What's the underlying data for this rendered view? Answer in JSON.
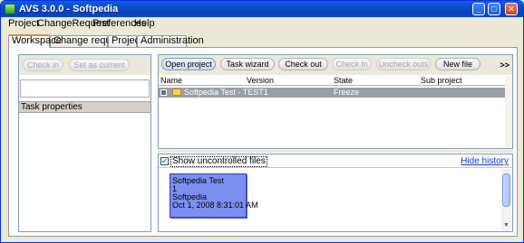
{
  "window": {
    "title": "AVS 3.0.0 - Softpedia",
    "controls": {
      "minimize": "_",
      "maximize": "□",
      "close": "✕"
    }
  },
  "menu": [
    "Project",
    "ChangeRequest",
    "Preferences",
    "Help"
  ],
  "tabs": [
    {
      "label": "Workspace",
      "active": true
    },
    {
      "label": "Change request",
      "active": false
    },
    {
      "label": "Project",
      "active": false
    },
    {
      "label": "Administration",
      "active": false
    }
  ],
  "left_pane": {
    "check_in_label": "Check in",
    "set_as_current_label": "Set as current",
    "task_properties_label": "Task properties"
  },
  "toolbar": {
    "open_project": "Open project",
    "task_wizard": "Task wizard",
    "check_out": "Check out",
    "check_in": "Check in",
    "uncheck_outs": "Uncheck outs",
    "new_file": "New file",
    "overflow": ">>"
  },
  "grid": {
    "columns": [
      "Name",
      "Version",
      "State",
      "Sub project"
    ],
    "rows": [
      {
        "name": "Softpedia Test - TEST1",
        "version": "",
        "state": "Freeze",
        "sub_project": ""
      }
    ]
  },
  "history": {
    "show_uncontrolled_label": "Show uncontrolled files",
    "show_uncontrolled_checked": true,
    "hide_history_label": "Hide history",
    "card": {
      "line1": "Softpedia Test",
      "line2": "1",
      "line3": "Softpedia",
      "line4": "Oct 1, 2008 8:31:01 AM"
    }
  },
  "colors": {
    "titlebar": "#0a5de8",
    "selected_row": "#9aa0a6",
    "history_card": "#7c8ff0",
    "link": "#1a3ccc"
  }
}
